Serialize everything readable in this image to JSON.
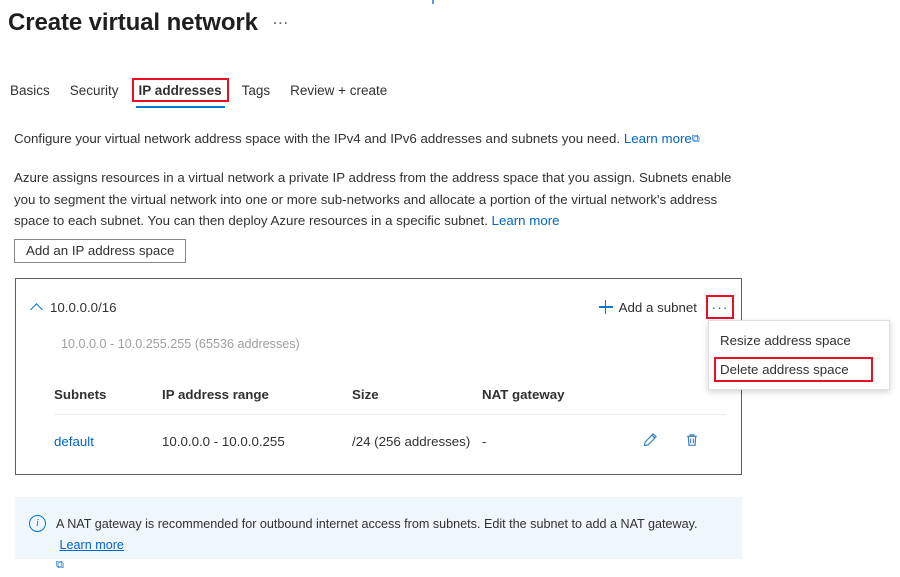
{
  "header": {
    "title": "Create virtual network",
    "more_label": "…"
  },
  "tabs": [
    {
      "label": "Basics",
      "selected": false
    },
    {
      "label": "Security",
      "selected": false
    },
    {
      "label": "IP addresses",
      "selected": true
    },
    {
      "label": "Tags",
      "selected": false
    },
    {
      "label": "Review + create",
      "selected": false
    }
  ],
  "description": {
    "line1": "Configure your virtual network address space with the IPv4 and IPv6 addresses and subnets you need.",
    "line1_link": "Learn more",
    "paragraph": "Azure assigns resources in a virtual network a private IP address from the address space that you assign. Subnets enable you to segment the virtual network into one or more sub-networks and allocate a portion of the virtual network's address space to each subnet. You can then deploy Azure resources in a specific subnet.",
    "paragraph_link": "Learn more"
  },
  "buttons": {
    "add_ip_address_space": "Add an IP address space"
  },
  "address_space": {
    "cidr": "10.0.0.0/16",
    "range_summary": "10.0.0.0 - 10.0.255.255 (65536 addresses)",
    "add_subnet_label": "Add a subnet",
    "more_label": "···"
  },
  "context_menu": {
    "items": [
      {
        "label": "Resize address space",
        "highlighted": false
      },
      {
        "label": "Delete address space",
        "highlighted": true
      }
    ]
  },
  "subnet_table": {
    "columns": [
      "Subnets",
      "IP address range",
      "Size",
      "NAT gateway"
    ],
    "rows": [
      {
        "name": "default",
        "ip_range": "10.0.0.0 - 10.0.0.255",
        "size": "/24 (256 addresses)",
        "nat_gateway": "-"
      }
    ]
  },
  "info_banner": {
    "text": "A NAT gateway is recommended for outbound internet access from subnets. Edit the subnet to add a NAT gateway.",
    "link": "Learn more"
  },
  "colors": {
    "accent": "#0078d4",
    "link": "#0066cc",
    "annotation": "#e81123",
    "banner_bg": "#eff6fc",
    "muted_text": "#a19f9d"
  }
}
